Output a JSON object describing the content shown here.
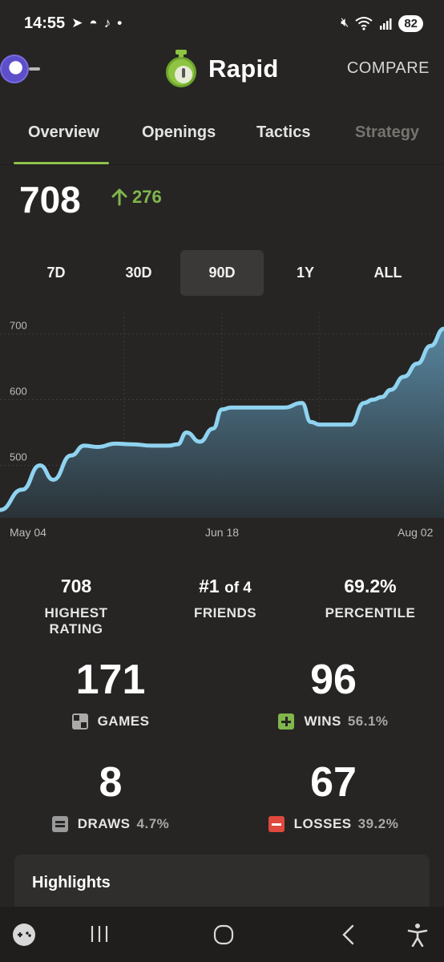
{
  "status_bar": {
    "time": "14:55",
    "dot": "•",
    "battery": "82",
    "icons": [
      "telegram-icon",
      "discord-icon",
      "tiktok-icon",
      "mute-icon",
      "wifi-icon",
      "signal-icon",
      "battery-icon"
    ]
  },
  "header": {
    "title": "Rapid",
    "compare_label": "COMPARE",
    "accent": "#81b64c"
  },
  "tabs": [
    {
      "label": "Overview",
      "active": true
    },
    {
      "label": "Openings",
      "active": false
    },
    {
      "label": "Tactics",
      "active": false
    },
    {
      "label": "Strategy",
      "active": false
    }
  ],
  "rating": {
    "current": "708",
    "change": "276"
  },
  "ranges": [
    {
      "label": "7D",
      "active": false
    },
    {
      "label": "30D",
      "active": false
    },
    {
      "label": "90D",
      "active": true
    },
    {
      "label": "1Y",
      "active": false
    },
    {
      "label": "ALL",
      "active": false
    }
  ],
  "chart_data": {
    "type": "area",
    "y_ticks": [
      "700",
      "600",
      "500"
    ],
    "x_ticks": [
      "May 04",
      "Jun 18",
      "Aug 02"
    ],
    "ylim": [
      420,
      730
    ],
    "grid": true,
    "line_color": "#8fd3f0",
    "x": [
      0,
      5,
      9,
      12,
      16,
      19,
      22,
      26,
      30,
      34,
      38,
      40,
      42,
      45,
      48,
      50,
      52,
      56,
      60,
      64,
      68,
      70,
      72,
      75,
      79,
      82,
      84,
      86,
      88,
      91,
      94,
      97,
      100
    ],
    "values": [
      432,
      463,
      500,
      478,
      515,
      530,
      528,
      533,
      532,
      530,
      530,
      532,
      550,
      536,
      556,
      585,
      588,
      588,
      588,
      588,
      595,
      566,
      562,
      562,
      562,
      595,
      600,
      604,
      615,
      635,
      655,
      682,
      708
    ]
  },
  "stats": {
    "highest_rating": {
      "value": "708",
      "label": "HIGHEST RATING"
    },
    "friends": {
      "rank": "#1",
      "of": "of 4",
      "label": "FRIENDS"
    },
    "percentile": {
      "value": "69.2%",
      "label": "PERCENTILE"
    }
  },
  "summary": {
    "games": {
      "value": "171",
      "label": "GAMES"
    },
    "wins": {
      "value": "96",
      "label": "WINS",
      "pct": "56.1%"
    },
    "draws": {
      "value": "8",
      "label": "DRAWS",
      "pct": "4.7%"
    },
    "losses": {
      "value": "67",
      "label": "LOSSES",
      "pct": "39.2%"
    }
  },
  "highlights": {
    "title": "Highlights"
  },
  "nav": [
    "game-controller-icon",
    "recent-apps-icon",
    "home-icon",
    "back-icon",
    "accessibility-icon"
  ]
}
